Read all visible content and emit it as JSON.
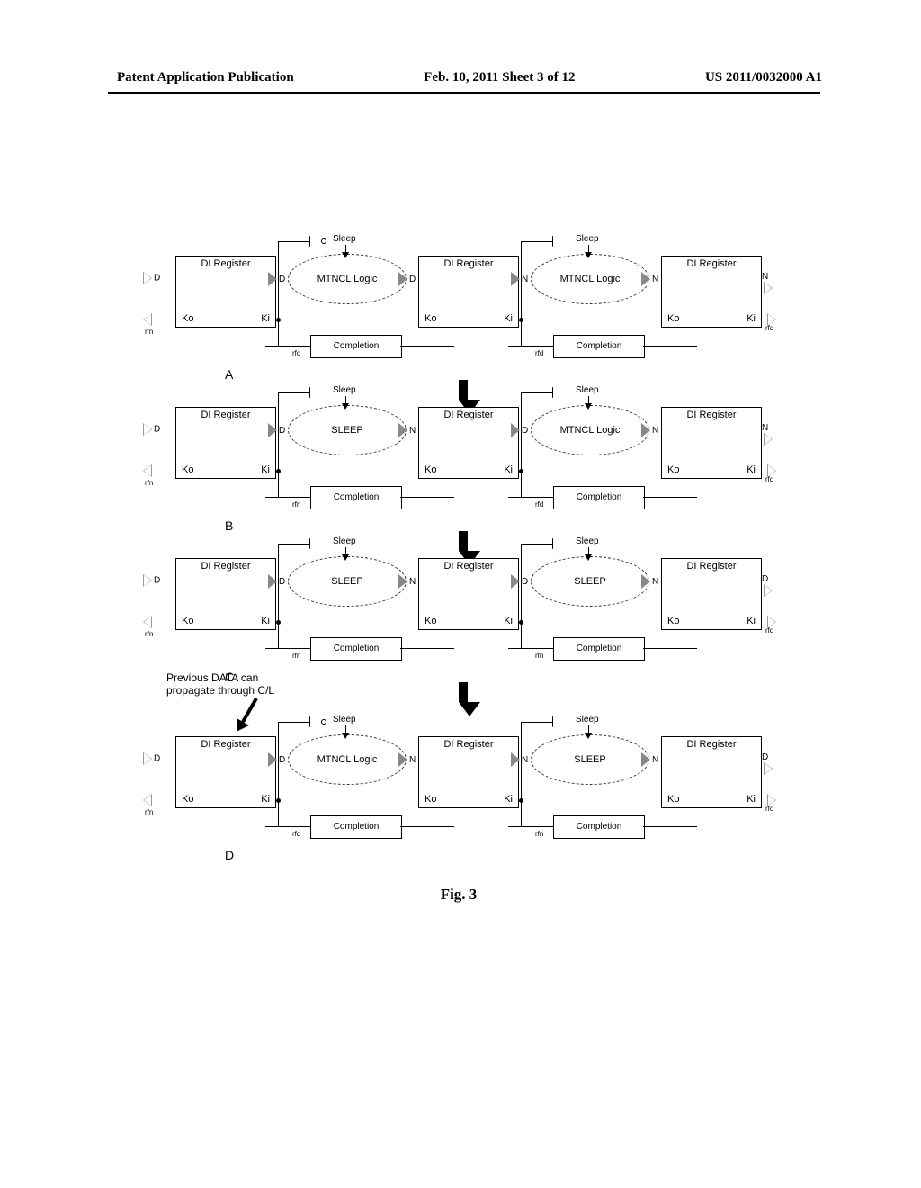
{
  "header": {
    "left": "Patent Application Publication",
    "center": "Feb. 10, 2011  Sheet 3 of 12",
    "right": "US 2011/0032000 A1"
  },
  "figure": {
    "caption": "Fig. 3",
    "annotation": "Previous DATA can\npropagate through C/L",
    "stage_arrow_label": "",
    "panels": [
      {
        "letter": "A",
        "left_in": "D",
        "right_out": "N",
        "left_ack_label": "rfn",
        "right_ack_label": "rfd",
        "sections": [
          {
            "reg": "DI Register",
            "ko": "Ko",
            "ki": "Ki",
            "logic": "MTNCL Logic",
            "completion": "Completion",
            "comp_ack": "rfd",
            "sleep": "Sleep",
            "port_left": "D",
            "port_right": "D",
            "buffer_invert": true
          },
          {
            "reg": "DI Register",
            "ko": "Ko",
            "ki": "Ki",
            "logic": "MTNCL Logic",
            "completion": "Completion",
            "comp_ack": "rfd",
            "sleep": "Sleep",
            "port_left": "N",
            "port_right": "N",
            "buffer_invert": false
          },
          {
            "reg": "DI Register",
            "ko": "Ko",
            "ki": "Ki",
            "logic": null,
            "completion": null,
            "comp_ack": null,
            "sleep": null,
            "port_left": null,
            "port_right": null,
            "buffer_invert": false
          }
        ]
      },
      {
        "letter": "B",
        "left_in": "D",
        "right_out": "N",
        "left_ack_label": "rfn",
        "right_ack_label": "rfd",
        "sections": [
          {
            "reg": "DI Register",
            "ko": "Ko",
            "ki": "Ki",
            "logic": "SLEEP",
            "completion": "Completion",
            "comp_ack": "rfn",
            "sleep": "Sleep",
            "port_left": "D",
            "port_right": "N",
            "buffer_invert": false
          },
          {
            "reg": "DI Register",
            "ko": "Ko",
            "ki": "Ki",
            "logic": "MTNCL Logic",
            "completion": "Completion",
            "comp_ack": "rfd",
            "sleep": "Sleep",
            "port_left": "D",
            "port_right": "N",
            "buffer_invert": false
          },
          {
            "reg": "DI Register",
            "ko": "Ko",
            "ki": "Ki",
            "logic": null,
            "completion": null,
            "comp_ack": null,
            "sleep": null,
            "port_left": null,
            "port_right": null,
            "buffer_invert": false
          }
        ]
      },
      {
        "letter": "C",
        "left_in": "D",
        "right_out": "D",
        "left_ack_label": "rfn",
        "right_ack_label": "rfd",
        "sections": [
          {
            "reg": "DI Register",
            "ko": "Ko",
            "ki": "Ki",
            "logic": "SLEEP",
            "completion": "Completion",
            "comp_ack": "rfn",
            "sleep": "Sleep",
            "port_left": "D",
            "port_right": "N",
            "buffer_invert": false
          },
          {
            "reg": "DI Register",
            "ko": "Ko",
            "ki": "Ki",
            "logic": "SLEEP",
            "completion": "Completion",
            "comp_ack": "rfn",
            "sleep": "Sleep",
            "port_left": "D",
            "port_right": "N",
            "buffer_invert": false
          },
          {
            "reg": "DI Register",
            "ko": "Ko",
            "ki": "Ki",
            "logic": null,
            "completion": null,
            "comp_ack": null,
            "sleep": null,
            "port_left": null,
            "port_right": null,
            "buffer_invert": false
          }
        ]
      },
      {
        "letter": "D",
        "left_in": "D",
        "right_out": "D",
        "left_ack_label": "rfn",
        "right_ack_label": "rfd",
        "sections": [
          {
            "reg": "DI Register",
            "ko": "Ko",
            "ki": "Ki",
            "logic": "MTNCL Logic",
            "completion": "Completion",
            "comp_ack": "rfd",
            "sleep": "Sleep",
            "port_left": "D",
            "port_right": "N",
            "buffer_invert": true
          },
          {
            "reg": "DI Register",
            "ko": "Ko",
            "ki": "Ki",
            "logic": "SLEEP",
            "completion": "Completion",
            "comp_ack": "rfn",
            "sleep": "Sleep",
            "port_left": "N",
            "port_right": "N",
            "buffer_invert": false
          },
          {
            "reg": "DI Register",
            "ko": "Ko",
            "ki": "Ki",
            "logic": null,
            "completion": null,
            "comp_ack": null,
            "sleep": null,
            "port_left": null,
            "port_right": null,
            "buffer_invert": false
          }
        ]
      }
    ]
  }
}
